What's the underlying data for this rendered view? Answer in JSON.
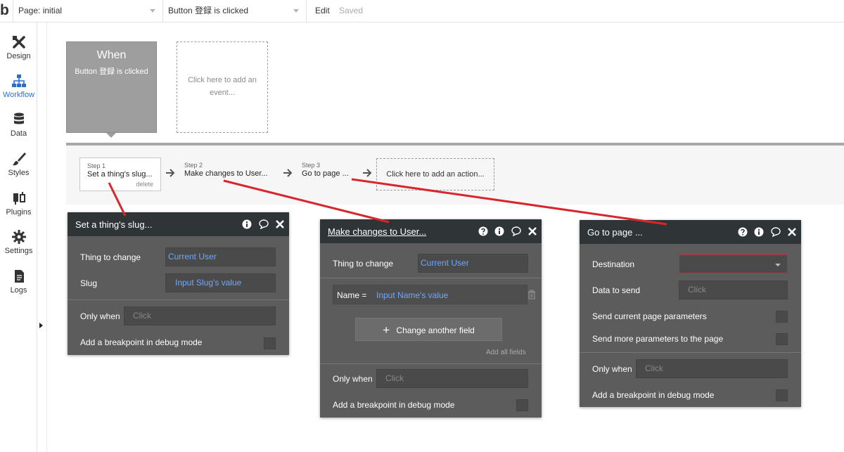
{
  "topbar": {
    "logo": "b",
    "page_select": "Page: initial",
    "event_select": "Button 登録 is clicked",
    "edit_label": "Edit",
    "saved_label": "Saved"
  },
  "sidebar": {
    "items": [
      {
        "label": "Design",
        "icon": "design-icon"
      },
      {
        "label": "Workflow",
        "icon": "workflow-icon"
      },
      {
        "label": "Data",
        "icon": "database-icon"
      },
      {
        "label": "Styles",
        "icon": "brush-icon"
      },
      {
        "label": "Plugins",
        "icon": "plug-icon"
      },
      {
        "label": "Settings",
        "icon": "gear-icon"
      },
      {
        "label": "Logs",
        "icon": "document-icon"
      }
    ],
    "active": "Workflow"
  },
  "events": {
    "when_title": "When",
    "when_subtitle": "Button 登録 is clicked",
    "add_event": "Click here to add an event..."
  },
  "actions": {
    "steps": [
      {
        "num": "Step 1",
        "name": "Set a thing's slug...",
        "delete": "delete"
      },
      {
        "num": "Step 2",
        "name": "Make changes to User..."
      },
      {
        "num": "Step 3",
        "name": "Go to page ..."
      }
    ],
    "add_action": "Click here to add an action..."
  },
  "panel1": {
    "title": "Set a thing's slug...",
    "thing_label": "Thing to change",
    "thing_value": "Current User",
    "slug_label": "Slug",
    "slug_value": "Input Slug's value",
    "only_when_label": "Only when",
    "only_when_placeholder": "Click",
    "breakpoint_label": "Add a breakpoint in debug mode"
  },
  "panel2": {
    "title": "Make changes to User...",
    "thing_label": "Thing to change",
    "thing_value": "Current User",
    "name_label": "Name  =",
    "name_value": "Input Name's value",
    "change_button": "Change another field",
    "add_all": "Add all fields",
    "only_when_label": "Only when",
    "only_when_placeholder": "Click",
    "breakpoint_label": "Add a breakpoint in debug mode"
  },
  "panel3": {
    "title": "Go to page ...",
    "destination_label": "Destination",
    "data_label": "Data to send",
    "data_placeholder": "Click",
    "send_current_label": "Send current page parameters",
    "send_more_label": "Send more parameters to the page",
    "only_when_label": "Only when",
    "only_when_placeholder": "Click",
    "breakpoint_label": "Add a breakpoint in debug mode"
  },
  "colors": {
    "accent": "#2b6ecf",
    "panel_bg": "#5c5c5c",
    "panel_header": "#2f3436",
    "link_value": "#6ea8ff",
    "annotation_red": "#d8262c",
    "invalid_border": "#c12c3a"
  }
}
